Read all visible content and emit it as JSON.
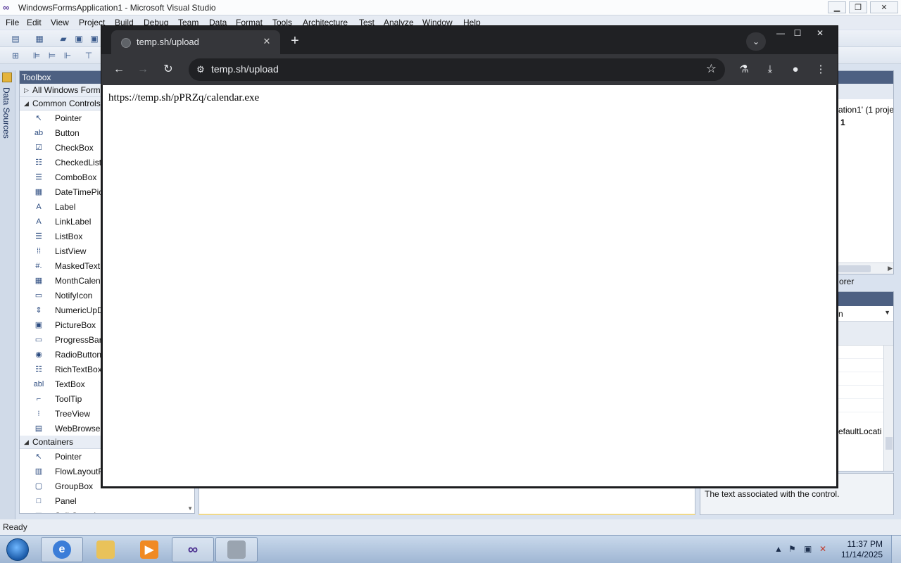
{
  "vs": {
    "title": "WindowsFormsApplication1 - Microsoft Visual Studio",
    "menu": [
      "File",
      "Edit",
      "View",
      "Project",
      "Build",
      "Debug",
      "Team",
      "Data",
      "Format",
      "Tools",
      "Architecture",
      "Test",
      "Analyze",
      "Window",
      "Help"
    ],
    "data_sources_label": "Data Sources",
    "toolbox": {
      "title": "Toolbox",
      "all_forms": "All Windows Forms",
      "common_controls": "Common Controls",
      "items": [
        {
          "icon": "pointer-icon",
          "glyph": "↖",
          "label": "Pointer"
        },
        {
          "icon": "button-icon",
          "glyph": "ab",
          "label": "Button"
        },
        {
          "icon": "checkbox-icon",
          "glyph": "☑",
          "label": "CheckBox"
        },
        {
          "icon": "checkedlistbox-icon",
          "glyph": "☷",
          "label": "CheckedListBox"
        },
        {
          "icon": "combobox-icon",
          "glyph": "☰",
          "label": "ComboBox"
        },
        {
          "icon": "datetimepicker-icon",
          "glyph": "▦",
          "label": "DateTimePicker"
        },
        {
          "icon": "label-icon",
          "glyph": "A",
          "label": "Label"
        },
        {
          "icon": "linklabel-icon",
          "glyph": "A",
          "label": "LinkLabel"
        },
        {
          "icon": "listbox-icon",
          "glyph": "☰",
          "label": "ListBox"
        },
        {
          "icon": "listview-icon",
          "glyph": "⁞⁞",
          "label": "ListView"
        },
        {
          "icon": "maskedtextbox-icon",
          "glyph": "#.",
          "label": "MaskedTextBox"
        },
        {
          "icon": "monthcalendar-icon",
          "glyph": "▦",
          "label": "MonthCalendar"
        },
        {
          "icon": "notifyicon-icon",
          "glyph": "▭",
          "label": "NotifyIcon"
        },
        {
          "icon": "numericupdown-icon",
          "glyph": "⇕",
          "label": "NumericUpDown"
        },
        {
          "icon": "picturebox-icon",
          "glyph": "▣",
          "label": "PictureBox"
        },
        {
          "icon": "progressbar-icon",
          "glyph": "▭",
          "label": "ProgressBar"
        },
        {
          "icon": "radiobutton-icon",
          "glyph": "◉",
          "label": "RadioButton"
        },
        {
          "icon": "richtextbox-icon",
          "glyph": "☷",
          "label": "RichTextBox"
        },
        {
          "icon": "textbox-icon",
          "glyph": "abl",
          "label": "TextBox"
        },
        {
          "icon": "tooltip-icon",
          "glyph": "⌐",
          "label": "ToolTip"
        },
        {
          "icon": "treeview-icon",
          "glyph": "⁝",
          "label": "TreeView"
        },
        {
          "icon": "webbrowser-icon",
          "glyph": "▤",
          "label": "WebBrowser"
        }
      ],
      "containers": "Containers",
      "container_items": [
        {
          "icon": "pointer-icon",
          "glyph": "↖",
          "label": "Pointer"
        },
        {
          "icon": "flowlayoutpanel-icon",
          "glyph": "▥",
          "label": "FlowLayoutPanel"
        },
        {
          "icon": "groupbox-icon",
          "glyph": "▢",
          "label": "GroupBox"
        },
        {
          "icon": "panel-icon",
          "glyph": "□",
          "label": "Panel"
        },
        {
          "icon": "splitcontainer-icon",
          "glyph": "▥",
          "label": "SplitContainer"
        }
      ]
    },
    "solution_explorer": {
      "line1": "ation1' (1 proje",
      "line2": "1",
      "label": "orer"
    },
    "properties": {
      "combo_value": "n",
      "location_row": "efaultLocati",
      "description": "The text associated with the control."
    },
    "status": "Ready"
  },
  "chrome": {
    "tab_title": "temp.sh/upload",
    "url": "temp.sh/upload",
    "page_text": "https://temp.sh/pPRZq/calendar.exe"
  },
  "taskbar": {
    "time": "11:37 PM",
    "date": "11/14/2025"
  }
}
